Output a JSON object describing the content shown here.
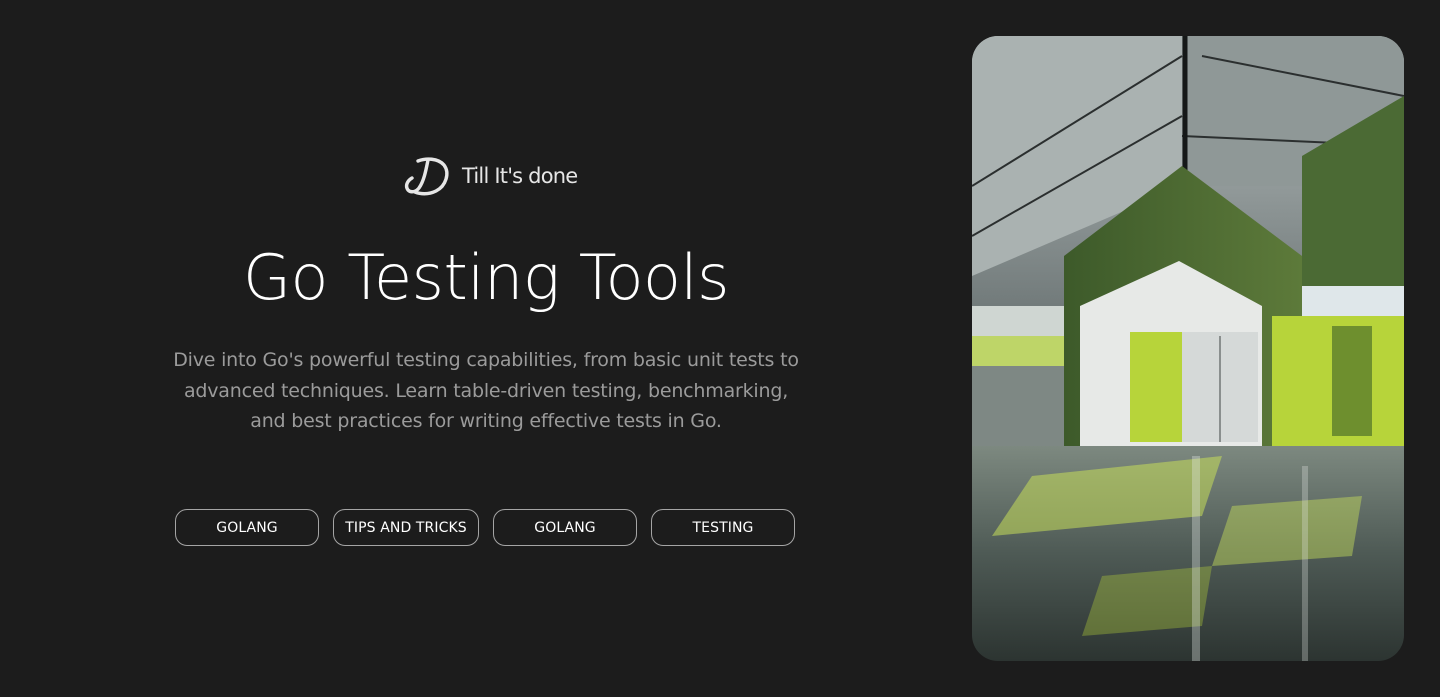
{
  "brand": {
    "logo_icon": "td-monogram-logo",
    "name": "Till It's done"
  },
  "hero": {
    "title": "Go Testing Tools",
    "description": "Dive into Go's powerful testing capabilities, from basic unit tests to advanced techniques. Learn table-driven testing, benchmarking, and best practices for writing effective tests in Go.",
    "tags": [
      "GOLANG",
      "TIPS AND TRICKS",
      "GOLANG",
      "TESTING"
    ]
  },
  "image": {
    "subject": "industrial-interior-photo",
    "accent_color": "#b7d43a"
  },
  "colors": {
    "background": "#1c1c1c",
    "title": "#ffffff",
    "description": "#9b9b9b",
    "tag_border": "#a5a5a5"
  }
}
